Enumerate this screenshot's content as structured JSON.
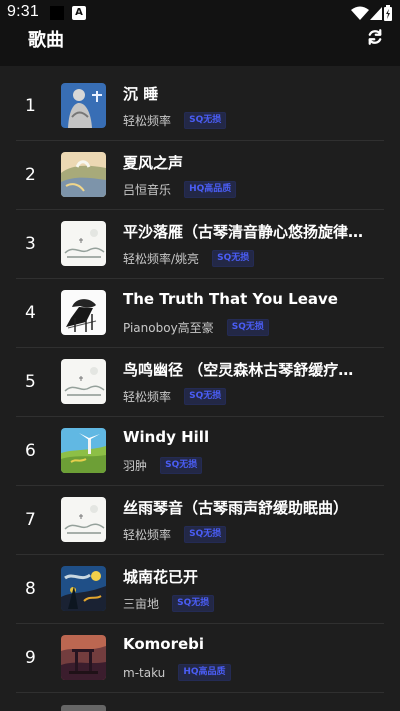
{
  "status": {
    "time": "9:31",
    "a_icon": "A"
  },
  "header": {
    "title": "歌曲"
  },
  "songs": [
    {
      "index": "1",
      "title": "沉 睡",
      "artist": "轻松频率",
      "quality": "SQ无损",
      "cover": "buddha"
    },
    {
      "index": "2",
      "title": "夏风之声",
      "artist": "吕恒音乐",
      "quality": "HQ高品质",
      "cover": "field"
    },
    {
      "index": "3",
      "title": "平沙落雁（古琴清音静心悠扬旋律…",
      "artist": "轻松频率/姚亮",
      "quality": "SQ无损",
      "cover": "ink"
    },
    {
      "index": "4",
      "title": "The Truth That You Leave",
      "artist": "Pianoboy高至豪",
      "quality": "SQ无损",
      "cover": "piano"
    },
    {
      "index": "5",
      "title": "鸟鸣幽径 （空灵森林古琴舒缓疗…",
      "artist": "轻松频率",
      "quality": "SQ无损",
      "cover": "ink"
    },
    {
      "index": "6",
      "title": "Windy Hill",
      "artist": "羽肿",
      "quality": "SQ无损",
      "cover": "windmill"
    },
    {
      "index": "7",
      "title": "丝雨琴音（古琴雨声舒缓助眠曲）",
      "artist": "轻松频率",
      "quality": "SQ无损",
      "cover": "ink"
    },
    {
      "index": "8",
      "title": "城南花已开",
      "artist": "三亩地",
      "quality": "SQ无损",
      "cover": "starry"
    },
    {
      "index": "9",
      "title": "Komorebi",
      "artist": "m-taku",
      "quality": "HQ高品质",
      "cover": "temple"
    }
  ],
  "colors": {
    "background": "#1e1e1e",
    "divider": "#303030",
    "badge_text": "#4a5df4",
    "badge_bg": "#232846"
  }
}
